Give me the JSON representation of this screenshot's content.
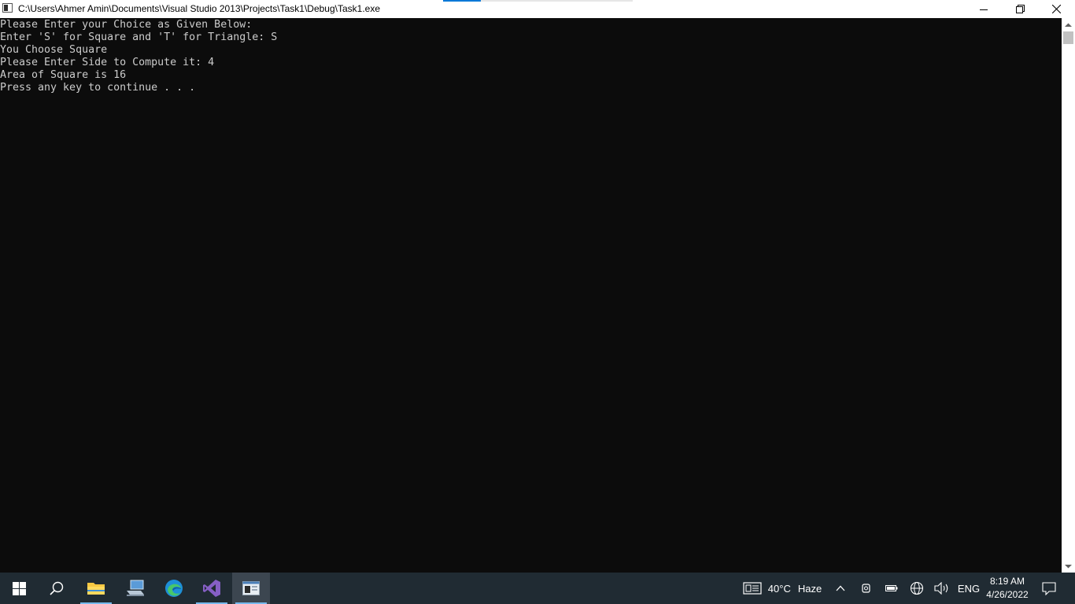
{
  "window": {
    "title": "C:\\Users\\Ahmer Amin\\Documents\\Visual Studio 2013\\Projects\\Task1\\Debug\\Task1.exe",
    "progress": 0.2
  },
  "console": {
    "lines": [
      "Please Enter your Choice as Given Below:",
      "Enter 'S' for Square and 'T' for Triangle: S",
      "You Choose Square",
      "Please Enter Side to Compute it: 4",
      "Area of Square is 16",
      "Press any key to continue . . ."
    ]
  },
  "taskbar": {
    "weather": {
      "temp": "40°C",
      "condition": "Haze"
    },
    "language": "ENG",
    "time": "8:19 AM",
    "date": "4/26/2022",
    "pinned": [
      "windows-start-icon",
      "search-icon",
      "file-explorer-icon",
      "network-computer-icon",
      "edge-icon",
      "visual-studio-icon",
      "console-app-icon"
    ]
  },
  "colors": {
    "console_bg": "#0c0c0c",
    "console_fg": "#cccccc",
    "taskbar_bg": "#202b33",
    "accent": "#0078d7"
  }
}
